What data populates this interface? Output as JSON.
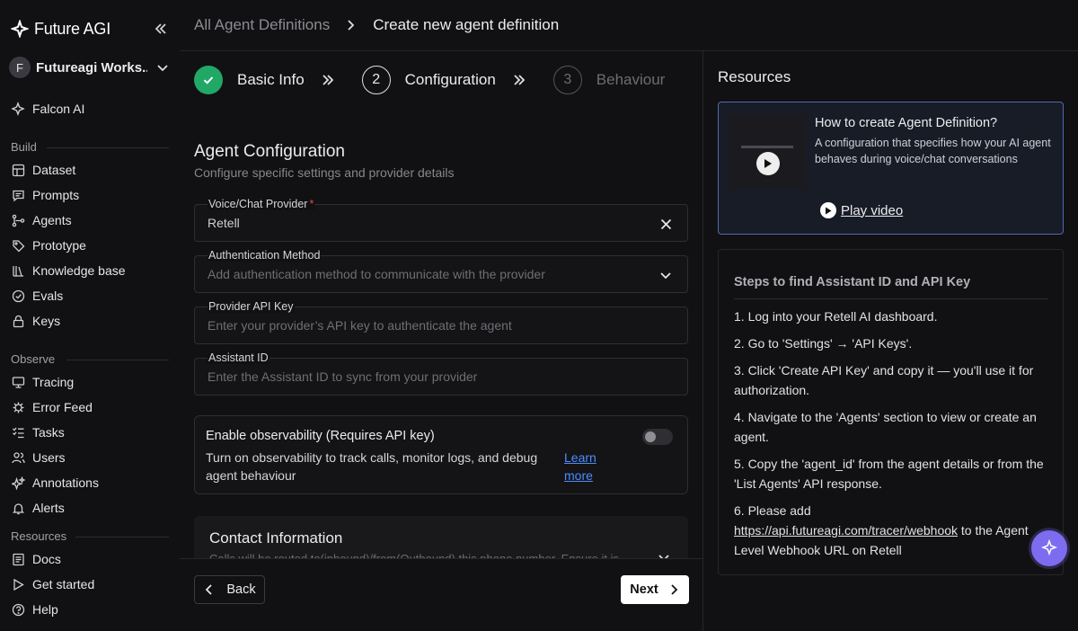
{
  "app": {
    "logo_text": "Future AGI"
  },
  "workspace": {
    "avatar_letter": "F",
    "name": "Futureagi Works..."
  },
  "sidebar": {
    "top_item": {
      "label": "Falcon AI",
      "icon": "falcon-icon"
    },
    "build_label": "Build",
    "build_items": [
      {
        "label": "Dataset",
        "icon": "table-icon"
      },
      {
        "label": "Prompts",
        "icon": "chat-icon"
      },
      {
        "label": "Agents",
        "icon": "agents-icon"
      },
      {
        "label": "Prototype",
        "icon": "tag-icon"
      },
      {
        "label": "Knowledge base",
        "icon": "books-icon"
      },
      {
        "label": "Evals",
        "icon": "check-circle-icon"
      },
      {
        "label": "Keys",
        "icon": "lock-icon"
      }
    ],
    "observe_label": "Observe",
    "observe_items": [
      {
        "label": "Tracing",
        "icon": "monitor-icon"
      },
      {
        "label": "Error Feed",
        "icon": "bug-icon"
      },
      {
        "label": "Tasks",
        "icon": "tasks-icon"
      },
      {
        "label": "Users",
        "icon": "users-icon"
      },
      {
        "label": "Annotations",
        "icon": "sparkle-icon"
      },
      {
        "label": "Alerts",
        "icon": "bell-icon"
      }
    ],
    "resources_label": "Resources",
    "resources_items": [
      {
        "label": "Docs",
        "icon": "doc-icon"
      },
      {
        "label": "Get started",
        "icon": "play-icon"
      },
      {
        "label": "Help",
        "icon": "help-icon"
      }
    ]
  },
  "breadcrumb": {
    "parent": "All Agent Definitions",
    "current": "Create new agent definition"
  },
  "stepper": {
    "steps": [
      {
        "number": "1",
        "label": "Basic Info",
        "state": "done"
      },
      {
        "number": "2",
        "label": "Configuration",
        "state": "active"
      },
      {
        "number": "3",
        "label": "Behaviour",
        "state": "idle"
      }
    ]
  },
  "config": {
    "title": "Agent Configuration",
    "subtitle": "Configure specific settings and provider details",
    "fields": {
      "provider": {
        "label": "Voice/Chat Provider",
        "required_mark": "*",
        "value": "Retell"
      },
      "auth": {
        "label": "Authentication Method",
        "placeholder": "Add authentication method to communicate with the provider"
      },
      "api_key": {
        "label": "Provider API Key",
        "placeholder": "Enter your provider’s API key to authenticate the agent"
      },
      "assistant_id": {
        "label": "Assistant ID",
        "placeholder": "Enter the Assistant ID to sync from your provider"
      }
    },
    "observability": {
      "title": "Enable observability (Requires API key)",
      "description": "Turn on observability to track calls, monitor logs, and debug agent behaviour",
      "learn_more": "Learn more",
      "enabled": false
    },
    "contact": {
      "title": "Contact Information",
      "description": "Calls will be routed to(inbound)/from(Outbound) this phone number. Ensure it is"
    }
  },
  "footer": {
    "back_label": "Back",
    "next_label": "Next"
  },
  "resources": {
    "title": "Resources",
    "video": {
      "title": "How to create Agent Definition?",
      "description": "A configuration that specifies how your AI agent behaves during voice/chat conversations",
      "play_label": "Play video"
    },
    "steps": {
      "title": "Steps to find Assistant ID and API Key",
      "items": [
        "1. Log into your Retell AI dashboard.",
        "2. Go to 'Settings' → 'API Keys'.",
        "3. Click 'Create API Key' and copy it — you'll use it for authorization.",
        "4. Navigate to the 'Agents' section to view or create an agent.",
        "5. Copy the 'agent_id' from the agent details or from the 'List Agents' API response."
      ],
      "item6_prefix": "6. Please add",
      "item6_link": "https://api.futureagi.com/tracer/webhook",
      "item6_suffix": " to the Agent Level Webhook URL on Retell"
    }
  },
  "colors": {
    "accent_green": "#21a866",
    "link_blue": "#4c8dff",
    "fab_purple": "#7d6cf0",
    "card_border_blue": "#4f6ba8"
  }
}
